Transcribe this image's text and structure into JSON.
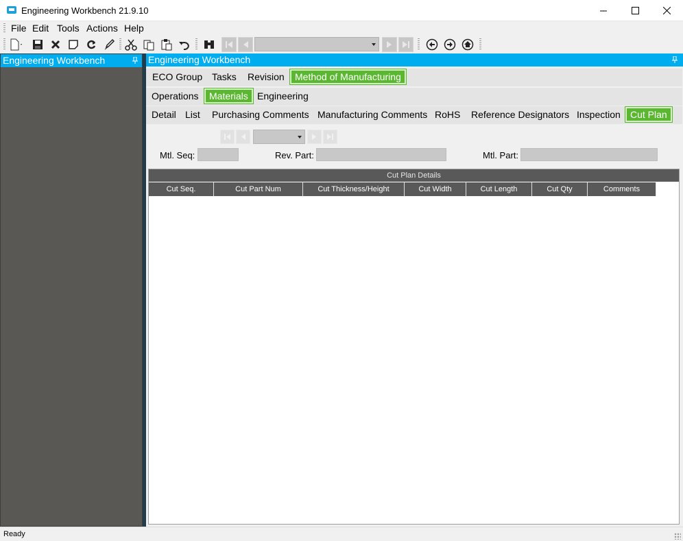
{
  "window": {
    "title": "Engineering Workbench 21.9.10",
    "minimize_icon": "minimize-icon",
    "maximize_icon": "maximize-icon",
    "close_icon": "close-icon"
  },
  "menu": [
    "File",
    "Edit",
    "Tools",
    "Actions",
    "Help"
  ],
  "toolbar": {
    "icons": [
      "new-icon",
      "save-icon",
      "delete-icon",
      "clear-icon",
      "refresh-icon",
      "undo-all-icon",
      "cut-icon",
      "copy-icon",
      "paste-icon",
      "undo-icon",
      "binoculars-icon",
      "first-record-icon",
      "previous-record-icon",
      "next-record-icon",
      "last-record-icon",
      "back-icon",
      "forward-icon",
      "home-icon"
    ],
    "record_combo_value": ""
  },
  "left_panel": {
    "title": "Engineering Workbench",
    "pin_icon": "pin-icon"
  },
  "right_panel": {
    "title": "Engineering Workbench",
    "tabs_level1": [
      "ECO Group",
      "Tasks",
      "Revision",
      "Method of Manufacturing"
    ],
    "tabs_level2": [
      "Operations",
      "Materials",
      "Engineering"
    ],
    "tabs_level3": [
      "Detail",
      "List",
      "Purchasing Comments",
      "Manufacturing Comments",
      "RoHS",
      "Reference Designators",
      "Inspection",
      "Cut Plan"
    ],
    "active": {
      "level1": "Method of Manufacturing",
      "level2": "Materials",
      "level3": "Cut Plan"
    }
  },
  "form": {
    "mtl_seq_label": "Mtl. Seq:",
    "mtl_seq_value": "",
    "rev_part_label": "Rev. Part:",
    "rev_part_value": "",
    "mtl_part_label": "Mtl. Part:",
    "mtl_part_value": ""
  },
  "grid": {
    "caption": "Cut Plan Details",
    "columns": [
      "Cut Seq.",
      "Cut Part Num",
      "Cut Thickness/Height",
      "Cut Width",
      "Cut Length",
      "Cut Qty",
      "Comments"
    ],
    "rows": []
  },
  "status": {
    "text": "Ready"
  },
  "colors": {
    "accent_blue": "#00aeef",
    "active_tab_green": "#5bb731",
    "panel_dark": "#5a5854",
    "grid_header": "#595959"
  }
}
